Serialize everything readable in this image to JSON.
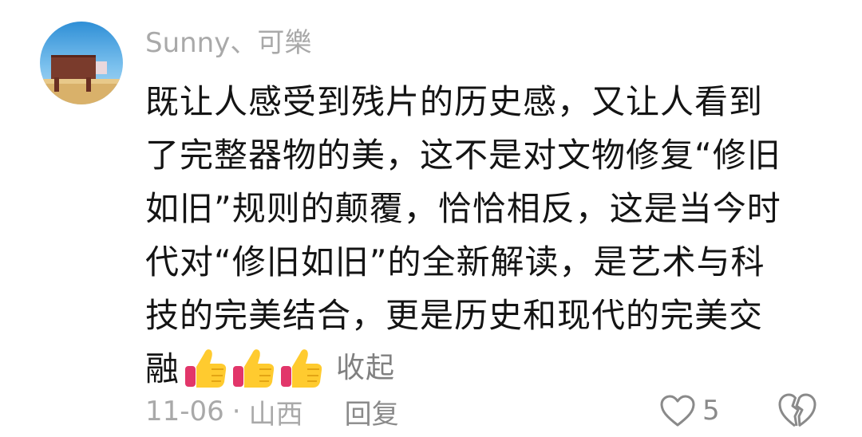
{
  "comment": {
    "username": "Sunny、可樂",
    "body_lines": [
      "既让人感受到残片的历史感，又让人看到",
      "了完整器物的美，这不是对文物修复“修旧",
      "如旧”规则的颠覆，恰恰相反，这是当今时",
      "代对“修旧如旧”的全新解读，是艺术与科",
      "技的完美结合，更是历史和现代的完美交",
      "融"
    ],
    "emojis": [
      "thumbs-up",
      "thumbs-up",
      "thumbs-up"
    ],
    "collapse_label": "收起",
    "date": "11-06",
    "separator": "·",
    "location": "山西",
    "reply_label": "回复",
    "like_count": "5"
  },
  "colors": {
    "meta_text": "#a9a9a9",
    "body_text": "#141414",
    "icon_stroke": "#8a8a8a"
  }
}
